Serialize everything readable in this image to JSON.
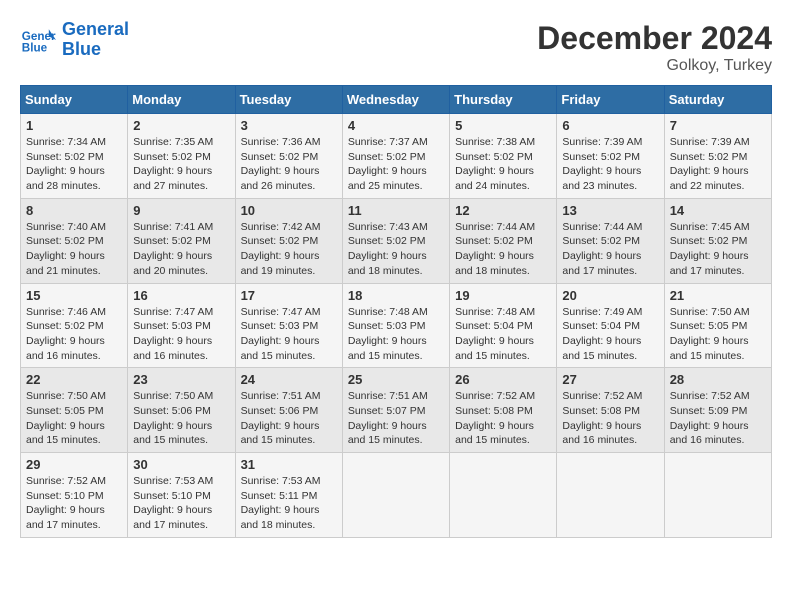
{
  "header": {
    "logo_line1": "General",
    "logo_line2": "Blue",
    "month": "December 2024",
    "location": "Golkoy, Turkey"
  },
  "columns": [
    "Sunday",
    "Monday",
    "Tuesday",
    "Wednesday",
    "Thursday",
    "Friday",
    "Saturday"
  ],
  "weeks": [
    [
      {
        "day": "1",
        "sunrise": "Sunrise: 7:34 AM",
        "sunset": "Sunset: 5:02 PM",
        "daylight": "Daylight: 9 hours and 28 minutes."
      },
      {
        "day": "2",
        "sunrise": "Sunrise: 7:35 AM",
        "sunset": "Sunset: 5:02 PM",
        "daylight": "Daylight: 9 hours and 27 minutes."
      },
      {
        "day": "3",
        "sunrise": "Sunrise: 7:36 AM",
        "sunset": "Sunset: 5:02 PM",
        "daylight": "Daylight: 9 hours and 26 minutes."
      },
      {
        "day": "4",
        "sunrise": "Sunrise: 7:37 AM",
        "sunset": "Sunset: 5:02 PM",
        "daylight": "Daylight: 9 hours and 25 minutes."
      },
      {
        "day": "5",
        "sunrise": "Sunrise: 7:38 AM",
        "sunset": "Sunset: 5:02 PM",
        "daylight": "Daylight: 9 hours and 24 minutes."
      },
      {
        "day": "6",
        "sunrise": "Sunrise: 7:39 AM",
        "sunset": "Sunset: 5:02 PM",
        "daylight": "Daylight: 9 hours and 23 minutes."
      },
      {
        "day": "7",
        "sunrise": "Sunrise: 7:39 AM",
        "sunset": "Sunset: 5:02 PM",
        "daylight": "Daylight: 9 hours and 22 minutes."
      }
    ],
    [
      {
        "day": "8",
        "sunrise": "Sunrise: 7:40 AM",
        "sunset": "Sunset: 5:02 PM",
        "daylight": "Daylight: 9 hours and 21 minutes."
      },
      {
        "day": "9",
        "sunrise": "Sunrise: 7:41 AM",
        "sunset": "Sunset: 5:02 PM",
        "daylight": "Daylight: 9 hours and 20 minutes."
      },
      {
        "day": "10",
        "sunrise": "Sunrise: 7:42 AM",
        "sunset": "Sunset: 5:02 PM",
        "daylight": "Daylight: 9 hours and 19 minutes."
      },
      {
        "day": "11",
        "sunrise": "Sunrise: 7:43 AM",
        "sunset": "Sunset: 5:02 PM",
        "daylight": "Daylight: 9 hours and 18 minutes."
      },
      {
        "day": "12",
        "sunrise": "Sunrise: 7:44 AM",
        "sunset": "Sunset: 5:02 PM",
        "daylight": "Daylight: 9 hours and 18 minutes."
      },
      {
        "day": "13",
        "sunrise": "Sunrise: 7:44 AM",
        "sunset": "Sunset: 5:02 PM",
        "daylight": "Daylight: 9 hours and 17 minutes."
      },
      {
        "day": "14",
        "sunrise": "Sunrise: 7:45 AM",
        "sunset": "Sunset: 5:02 PM",
        "daylight": "Daylight: 9 hours and 17 minutes."
      }
    ],
    [
      {
        "day": "15",
        "sunrise": "Sunrise: 7:46 AM",
        "sunset": "Sunset: 5:02 PM",
        "daylight": "Daylight: 9 hours and 16 minutes."
      },
      {
        "day": "16",
        "sunrise": "Sunrise: 7:47 AM",
        "sunset": "Sunset: 5:03 PM",
        "daylight": "Daylight: 9 hours and 16 minutes."
      },
      {
        "day": "17",
        "sunrise": "Sunrise: 7:47 AM",
        "sunset": "Sunset: 5:03 PM",
        "daylight": "Daylight: 9 hours and 15 minutes."
      },
      {
        "day": "18",
        "sunrise": "Sunrise: 7:48 AM",
        "sunset": "Sunset: 5:03 PM",
        "daylight": "Daylight: 9 hours and 15 minutes."
      },
      {
        "day": "19",
        "sunrise": "Sunrise: 7:48 AM",
        "sunset": "Sunset: 5:04 PM",
        "daylight": "Daylight: 9 hours and 15 minutes."
      },
      {
        "day": "20",
        "sunrise": "Sunrise: 7:49 AM",
        "sunset": "Sunset: 5:04 PM",
        "daylight": "Daylight: 9 hours and 15 minutes."
      },
      {
        "day": "21",
        "sunrise": "Sunrise: 7:50 AM",
        "sunset": "Sunset: 5:05 PM",
        "daylight": "Daylight: 9 hours and 15 minutes."
      }
    ],
    [
      {
        "day": "22",
        "sunrise": "Sunrise: 7:50 AM",
        "sunset": "Sunset: 5:05 PM",
        "daylight": "Daylight: 9 hours and 15 minutes."
      },
      {
        "day": "23",
        "sunrise": "Sunrise: 7:50 AM",
        "sunset": "Sunset: 5:06 PM",
        "daylight": "Daylight: 9 hours and 15 minutes."
      },
      {
        "day": "24",
        "sunrise": "Sunrise: 7:51 AM",
        "sunset": "Sunset: 5:06 PM",
        "daylight": "Daylight: 9 hours and 15 minutes."
      },
      {
        "day": "25",
        "sunrise": "Sunrise: 7:51 AM",
        "sunset": "Sunset: 5:07 PM",
        "daylight": "Daylight: 9 hours and 15 minutes."
      },
      {
        "day": "26",
        "sunrise": "Sunrise: 7:52 AM",
        "sunset": "Sunset: 5:08 PM",
        "daylight": "Daylight: 9 hours and 15 minutes."
      },
      {
        "day": "27",
        "sunrise": "Sunrise: 7:52 AM",
        "sunset": "Sunset: 5:08 PM",
        "daylight": "Daylight: 9 hours and 16 minutes."
      },
      {
        "day": "28",
        "sunrise": "Sunrise: 7:52 AM",
        "sunset": "Sunset: 5:09 PM",
        "daylight": "Daylight: 9 hours and 16 minutes."
      }
    ],
    [
      {
        "day": "29",
        "sunrise": "Sunrise: 7:52 AM",
        "sunset": "Sunset: 5:10 PM",
        "daylight": "Daylight: 9 hours and 17 minutes."
      },
      {
        "day": "30",
        "sunrise": "Sunrise: 7:53 AM",
        "sunset": "Sunset: 5:10 PM",
        "daylight": "Daylight: 9 hours and 17 minutes."
      },
      {
        "day": "31",
        "sunrise": "Sunrise: 7:53 AM",
        "sunset": "Sunset: 5:11 PM",
        "daylight": "Daylight: 9 hours and 18 minutes."
      },
      {
        "day": "",
        "sunrise": "",
        "sunset": "",
        "daylight": ""
      },
      {
        "day": "",
        "sunrise": "",
        "sunset": "",
        "daylight": ""
      },
      {
        "day": "",
        "sunrise": "",
        "sunset": "",
        "daylight": ""
      },
      {
        "day": "",
        "sunrise": "",
        "sunset": "",
        "daylight": ""
      }
    ]
  ]
}
